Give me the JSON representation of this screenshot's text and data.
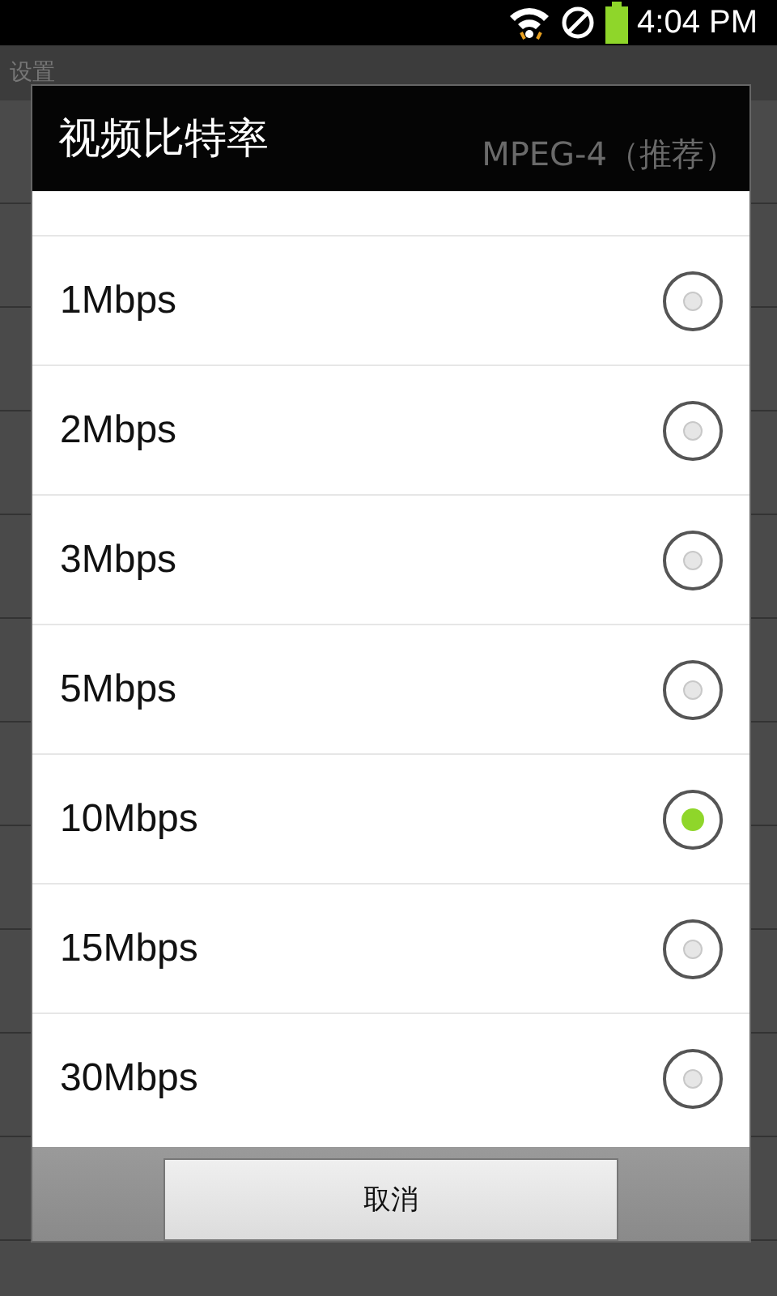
{
  "status_bar": {
    "time": "4:04 PM"
  },
  "background": {
    "title": "设置"
  },
  "dialog": {
    "title": "视频比特率",
    "behind_text": "MPEG-4（推荐）",
    "options": [
      {
        "label": "1Mbps",
        "selected": false
      },
      {
        "label": "2Mbps",
        "selected": false
      },
      {
        "label": "3Mbps",
        "selected": false
      },
      {
        "label": "5Mbps",
        "selected": false
      },
      {
        "label": "10Mbps",
        "selected": true
      },
      {
        "label": "15Mbps",
        "selected": false
      },
      {
        "label": "30Mbps",
        "selected": false
      }
    ],
    "cancel": "取消"
  }
}
